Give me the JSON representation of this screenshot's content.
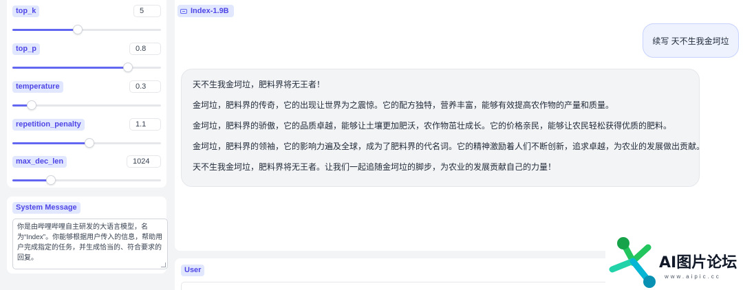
{
  "params": [
    {
      "label": "top_k",
      "value": "5",
      "fraction": 0.44
    },
    {
      "label": "top_p",
      "value": "0.8",
      "fraction": 0.78
    },
    {
      "label": "temperature",
      "value": "0.3",
      "fraction": 0.13
    },
    {
      "label": "repetition_penalty",
      "value": "1.1",
      "fraction": 0.52
    },
    {
      "label": "max_dec_len",
      "value": "1024",
      "fraction": 0.26
    }
  ],
  "system_message": {
    "label": "System Message",
    "text": "你是由哔哩哔哩自主研发的大语言模型，名为“Index”。你能够根据用户传入的信息，帮助用户完成指定的任务，并生成恰当的、符合要求的回复。"
  },
  "chat": {
    "model_tag": "Index-1.9B",
    "user_message": "续写 天不生我金坷垃",
    "bot_paragraphs": [
      "天不生我金坷垃，肥料界将无王者！",
      "金坷垃，肥料界的传奇，它的出现让世界为之震惊。它的配方独特，营养丰富，能够有效提高农作物的产量和质量。",
      "金坷垃，肥料界的骄傲，它的品质卓越，能够让土壤更加肥沃，农作物茁壮成长。它的价格亲民，能够让农民轻松获得优质的肥料。",
      "金坷垃，肥料界的领袖，它的影响力遍及全球，成为了肥料界的代名词。它的精神激励着人们不断创新，追求卓越，为农业的发展做出贡献。",
      "天不生我金坷垃，肥料界将无王者。让我们一起追随金坷垃的脚步，为农业的发展贡献自己的力量！"
    ]
  },
  "user_input": {
    "label": "User"
  },
  "watermark": {
    "text": "AI图片论坛",
    "url": "www.aipic.cc"
  },
  "colors": {
    "accent": "#6366f1",
    "label_bg": "#e0e7ff",
    "logo_green": "#22c55e",
    "logo_teal": "#06b6d4"
  }
}
